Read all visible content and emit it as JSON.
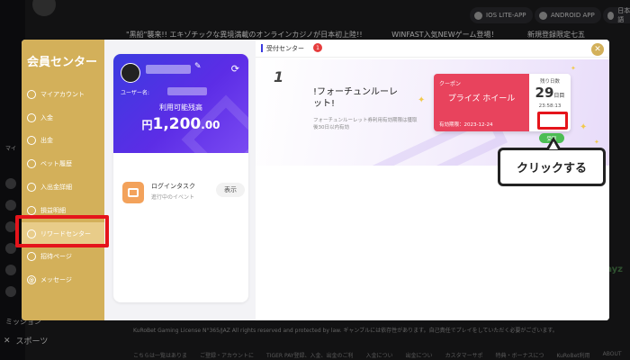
{
  "background": {
    "top_buttons": [
      {
        "label": "IOS LITE-APP",
        "icon": "apple-icon"
      },
      {
        "label": "ANDROID APP",
        "icon": "android-icon"
      },
      {
        "label": "日本語",
        "icon": "language-icon"
      }
    ],
    "marquee": [
      "\"黒船\"襲来!! エキゾチックな異境満載のオンラインカジノが日本初上陸!!",
      "WINFAST入気NEWゲーム登場！",
      "新規登録限定七五"
    ],
    "sidebar_partial_label": "マイ",
    "sidebar_bottom_partial": "ミッション",
    "sports_label": "スポーツ",
    "payz_partial": "ayz",
    "license_text": "KuRoBet Gaming License N°365/JAZ All rights reserved and protected by law. ギャンブルには依存性があります。自己責任でプレイをしていただく必要がございます。",
    "footer_links": [
      "こちらは一覧はありま",
      "ご登録・アカウントに",
      "TIGER PAY登録、入金、出金のご利",
      "入金につい",
      "出金につい",
      "カスタマーサポ",
      "特典・ボーナスにつ",
      "KuRoBet利用",
      "ABOUT"
    ]
  },
  "modal": {
    "title": "会員センター",
    "nav": [
      {
        "label": "マイアカウント",
        "icon": "account-icon",
        "active": false
      },
      {
        "label": "入金",
        "icon": "deposit-icon",
        "active": false
      },
      {
        "label": "出金",
        "icon": "withdraw-icon",
        "active": false
      },
      {
        "label": "ベット履歴",
        "icon": "bet-history-icon",
        "active": false
      },
      {
        "label": "入出金詳細",
        "icon": "transaction-icon",
        "active": false
      },
      {
        "label": "損益明細",
        "icon": "profit-icon",
        "active": false
      },
      {
        "label": "リワードセンター",
        "icon": "reward-icon",
        "active": true
      },
      {
        "label": "招待ページ",
        "icon": "invite-icon",
        "active": false
      },
      {
        "label": "メッセージ",
        "icon": "message-icon",
        "active": false
      }
    ],
    "account": {
      "username_label": "ユーザー名:",
      "available_label": "利用可能残高",
      "currency": "円",
      "amount": "1,200",
      "decimals": ".00"
    },
    "task": {
      "name": "ログインタスク",
      "sub": "進行中のイベント",
      "button": "表示"
    },
    "received": {
      "title": "受付センター",
      "badge": "1",
      "index": "1",
      "promo_title": "!フォーチュンルーレット!",
      "promo_desc": "フォーチュンルーレット券利用有効期限は獲取後30日以内有効",
      "coupon": {
        "type": "クーポン",
        "name": "プライズ ホイール",
        "expiry": "有効期限：2023-12-24",
        "remaining_label": "残り日数",
        "days": "29",
        "days_unit": "日目",
        "time": "23:58:13",
        "claim_label": "受取"
      }
    },
    "callout": "クリックする"
  },
  "colors": {
    "sidebar_gold": "#d3b05a",
    "active_nav": "#e8cc89",
    "card_blue": "#3b3be0",
    "coupon_red": "#e8435d",
    "claim_green": "#4cbd54",
    "highlight_red": "#e5141b"
  }
}
